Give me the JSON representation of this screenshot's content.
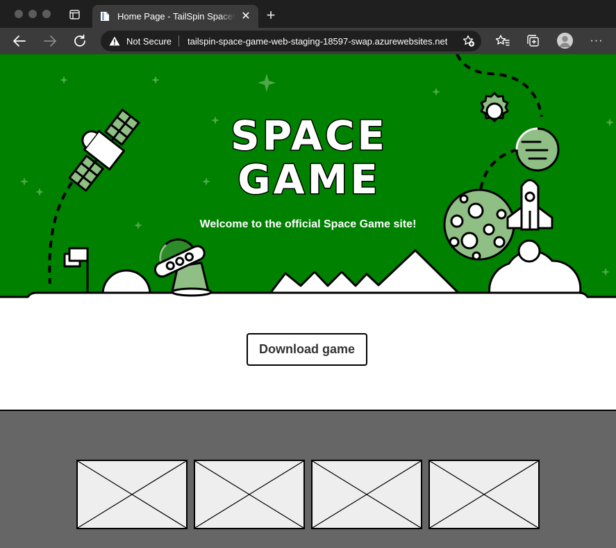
{
  "browser": {
    "tab_title": "Home Page - TailSpin SpaceGame",
    "security_label": "Not Secure",
    "url": "tailspin-space-game-web-staging-18597-swap.azurewebsites.net",
    "new_tab_symbol": "+",
    "close_tab_symbol": "✕",
    "more_symbol": "···",
    "icons": [
      "tab-actions-icon",
      "document-icon",
      "back-arrow-icon",
      "forward-arrow-icon",
      "refresh-icon",
      "warning-icon",
      "add-favorite-icon",
      "favorites-icon",
      "collections-icon",
      "profile-icon",
      "more-icon"
    ]
  },
  "hero": {
    "title_line1": "SPACE",
    "title_line2": "GAME",
    "welcome": "Welcome to the official Space Game site!"
  },
  "download": {
    "label": "Download game"
  },
  "gallery": {
    "thumbnail_count": 4
  },
  "colors": {
    "hero_green": "#008100",
    "light_green": "#8fbf85",
    "gallery_gray": "#666666",
    "chrome_dark": "#1f1f1f",
    "chrome_toolbar": "#3b3b3b"
  }
}
